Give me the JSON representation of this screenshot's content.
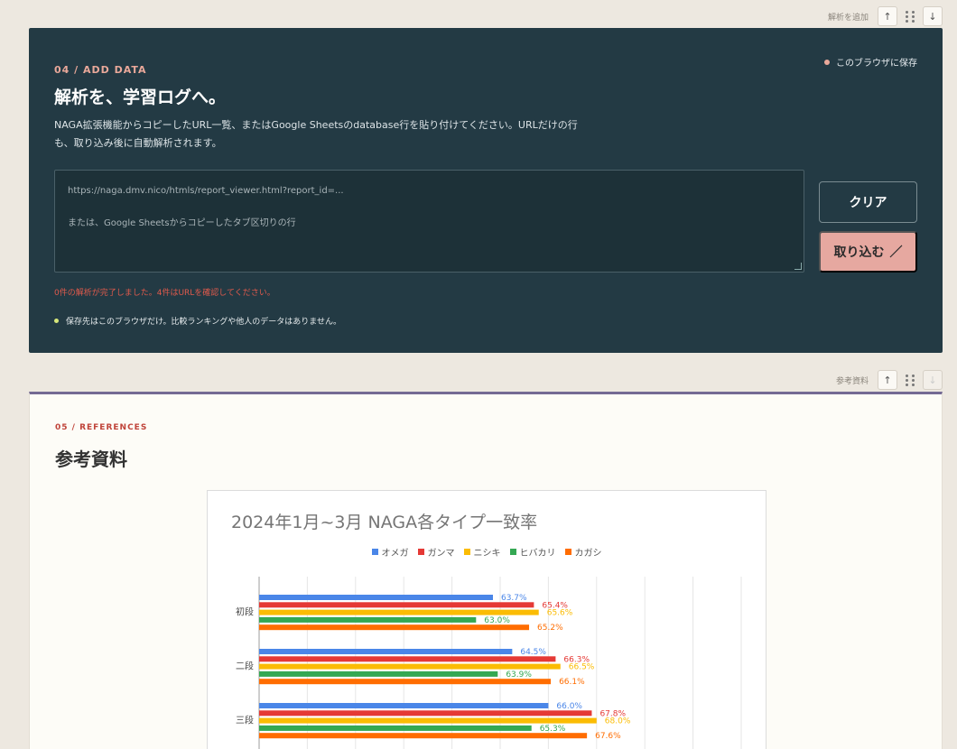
{
  "toolbar_add": {
    "label": "解析を追加",
    "up": "↑",
    "down": "↓"
  },
  "toolbar_ref": {
    "label": "参考資料",
    "up": "↑",
    "down": "↓"
  },
  "add_data": {
    "eyebrow": "04 / ADD DATA",
    "title": "解析を、学習ログへ。",
    "description": "NAGA拡張機能からコピーしたURL一覧、またはGoogle Sheetsのdatabase行を貼り付けてください。URLだけの行も、取り込み後に自動解析されます。",
    "save_local": "このブラウザに保存",
    "placeholder_line1": "https://naga.dmv.nico/htmls/report_viewer.html?report_id=...",
    "placeholder_line2": "または、Google Sheetsからコピーしたタブ区切りの行",
    "clear_label": "クリア",
    "import_label": "取り込む",
    "import_icon": "／",
    "status": "0件の解析が完了しました。4件はURLを確認してください。",
    "note": "保存先はこのブラウザだけ。比較ランキングや他人のデータはありません。"
  },
  "references": {
    "eyebrow": "05 / REFERENCES",
    "title": "参考資料"
  },
  "chart_data": {
    "type": "bar",
    "orientation": "horizontal",
    "title": "2024年1月~3月 NAGA各タイプ一致率",
    "legend_position": "top",
    "grid": true,
    "categories": [
      "初段",
      "二段",
      "三段"
    ],
    "series": [
      {
        "name": "オメガ",
        "color": "#4a86e8",
        "values": [
          63.7,
          64.5,
          66.0
        ],
        "labels": [
          "63.7%",
          "64.5%",
          "66.0%"
        ]
      },
      {
        "name": "ガンマ",
        "color": "#e53935",
        "values": [
          65.4,
          66.3,
          67.8
        ],
        "labels": [
          "65.4%",
          "66.3%",
          "67.8%"
        ]
      },
      {
        "name": "ニシキ",
        "color": "#fbbc04",
        "values": [
          65.6,
          66.5,
          68.0
        ],
        "labels": [
          "65.6%",
          "66.5%",
          "68.0%"
        ]
      },
      {
        "name": "ヒバカリ",
        "color": "#34a853",
        "values": [
          63.0,
          63.9,
          65.3
        ],
        "labels": [
          "63.0%",
          "63.9%",
          "65.3%"
        ]
      },
      {
        "name": "カガシ",
        "color": "#ff6d01",
        "values": [
          65.2,
          66.1,
          67.6
        ],
        "labels": [
          "65.2%",
          "66.1%",
          "67.6%"
        ]
      }
    ]
  }
}
